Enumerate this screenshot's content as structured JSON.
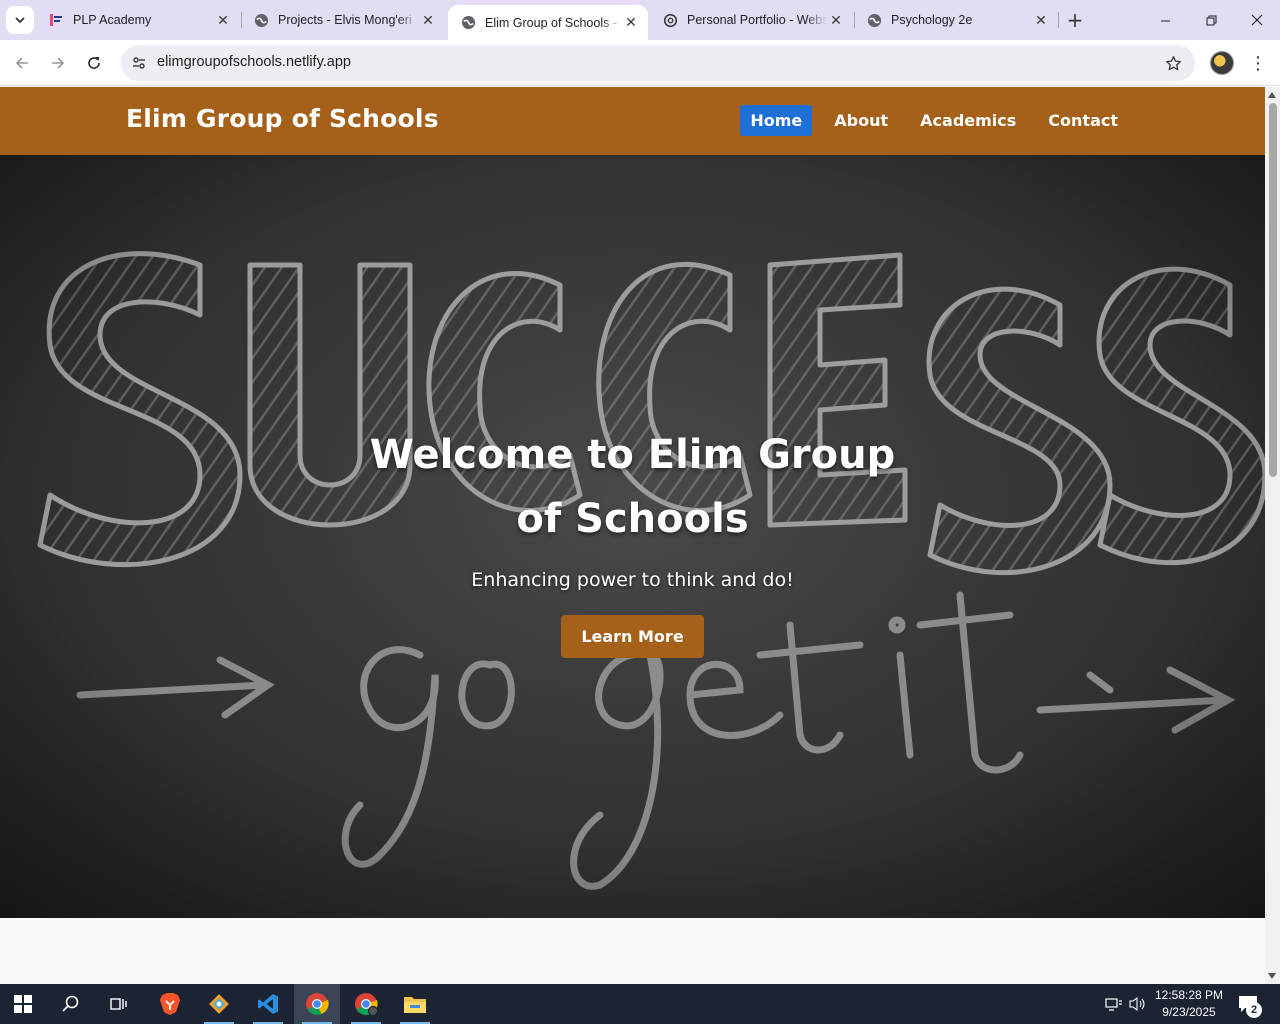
{
  "browser": {
    "tabs": [
      {
        "title": "PLP Academy",
        "icon": "plp-logo-icon"
      },
      {
        "title": "Projects - Elvis Mong'eri",
        "icon": "globe-icon"
      },
      {
        "title": "Elim Group of Schools - Home",
        "icon": "globe-icon",
        "active": true
      },
      {
        "title": "Personal Portfolio - Website",
        "icon": "openai-icon"
      },
      {
        "title": "Psychology 2e",
        "icon": "globe-icon"
      }
    ],
    "address": "elimgroupofschools.netlify.app"
  },
  "site": {
    "brand": "Elim Group of Schools",
    "nav": [
      {
        "label": "Home",
        "active": true
      },
      {
        "label": "About"
      },
      {
        "label": "Academics"
      },
      {
        "label": "Contact"
      }
    ],
    "hero": {
      "title": "Welcome to Elim Group of Schools",
      "subtitle": "Enhancing power to think and do!",
      "cta": "Learn More"
    },
    "colors": {
      "header": "#a5601a",
      "nav_active": "#1e6fd6",
      "button": "#a5601a"
    }
  },
  "taskbar": {
    "apps": [
      "start-icon",
      "search-icon",
      "task-view-icon",
      "brave-icon",
      "git-icon",
      "vscode-icon",
      "chrome-icon",
      "chrome-alt-icon",
      "file-explorer-icon"
    ],
    "time": "12:58:28 PM",
    "date": "9/23/2025",
    "notification_count": "2"
  }
}
